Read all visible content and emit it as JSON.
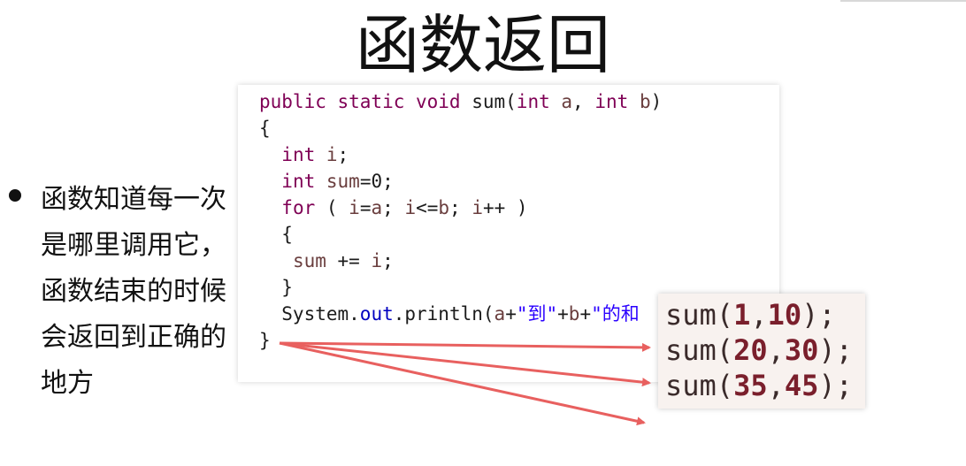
{
  "slide": {
    "title": "函数返回",
    "bullet": "函数知道每一次是哪里调用它，函数结束的时候会返回到正确的地方"
  },
  "code": {
    "lines": [
      [
        {
          "t": "public static void",
          "c": "kw"
        },
        {
          "t": " sum(",
          "c": ""
        },
        {
          "t": "int",
          "c": "kw"
        },
        {
          "t": " ",
          "c": ""
        },
        {
          "t": "a",
          "c": "var"
        },
        {
          "t": ", ",
          "c": ""
        },
        {
          "t": "int",
          "c": "kw"
        },
        {
          "t": " ",
          "c": ""
        },
        {
          "t": "b",
          "c": "var"
        },
        {
          "t": ")",
          "c": ""
        }
      ],
      [
        {
          "t": "{",
          "c": ""
        }
      ],
      [
        {
          "t": "  ",
          "c": ""
        },
        {
          "t": "int",
          "c": "kw"
        },
        {
          "t": " ",
          "c": ""
        },
        {
          "t": "i",
          "c": "var"
        },
        {
          "t": ";",
          "c": ""
        }
      ],
      [
        {
          "t": "  ",
          "c": ""
        },
        {
          "t": "int",
          "c": "kw"
        },
        {
          "t": " ",
          "c": ""
        },
        {
          "t": "sum",
          "c": "var"
        },
        {
          "t": "=0;",
          "c": ""
        }
      ],
      [
        {
          "t": "  ",
          "c": ""
        },
        {
          "t": "for",
          "c": "kw"
        },
        {
          "t": " ( ",
          "c": ""
        },
        {
          "t": "i",
          "c": "var"
        },
        {
          "t": "=",
          "c": ""
        },
        {
          "t": "a",
          "c": "var"
        },
        {
          "t": "; ",
          "c": ""
        },
        {
          "t": "i",
          "c": "var"
        },
        {
          "t": "<=",
          "c": ""
        },
        {
          "t": "b",
          "c": "var"
        },
        {
          "t": "; ",
          "c": ""
        },
        {
          "t": "i",
          "c": "var"
        },
        {
          "t": "++ )",
          "c": ""
        }
      ],
      [
        {
          "t": "  {",
          "c": ""
        }
      ],
      [
        {
          "t": "   ",
          "c": ""
        },
        {
          "t": "sum",
          "c": "var"
        },
        {
          "t": " += ",
          "c": ""
        },
        {
          "t": "i",
          "c": "var"
        },
        {
          "t": ";",
          "c": ""
        }
      ],
      [
        {
          "t": "  }",
          "c": ""
        }
      ],
      [
        {
          "t": "  System.",
          "c": ""
        },
        {
          "t": "out",
          "c": "fld"
        },
        {
          "t": ".println(",
          "c": ""
        },
        {
          "t": "a",
          "c": "var"
        },
        {
          "t": "+",
          "c": ""
        },
        {
          "t": "\"到\"",
          "c": "str"
        },
        {
          "t": "+",
          "c": ""
        },
        {
          "t": "b",
          "c": "var"
        },
        {
          "t": "+",
          "c": ""
        },
        {
          "t": "\"的和",
          "c": "str"
        }
      ],
      [
        {
          "t": "}",
          "c": ""
        }
      ]
    ]
  },
  "calls": [
    {
      "prefix": "sum(",
      "a": "1",
      "b": "10",
      "suffix": ");"
    },
    {
      "prefix": "sum(",
      "a": "20",
      "b": "30",
      "suffix": ");"
    },
    {
      "prefix": "sum(",
      "a": "35",
      "b": "45",
      "suffix": ");"
    }
  ],
  "colors": {
    "keyword": "#7f0055",
    "variable": "#6a3e3e",
    "field": "#0000c0",
    "string": "#2a00ff",
    "arrow": "#e8605f"
  }
}
